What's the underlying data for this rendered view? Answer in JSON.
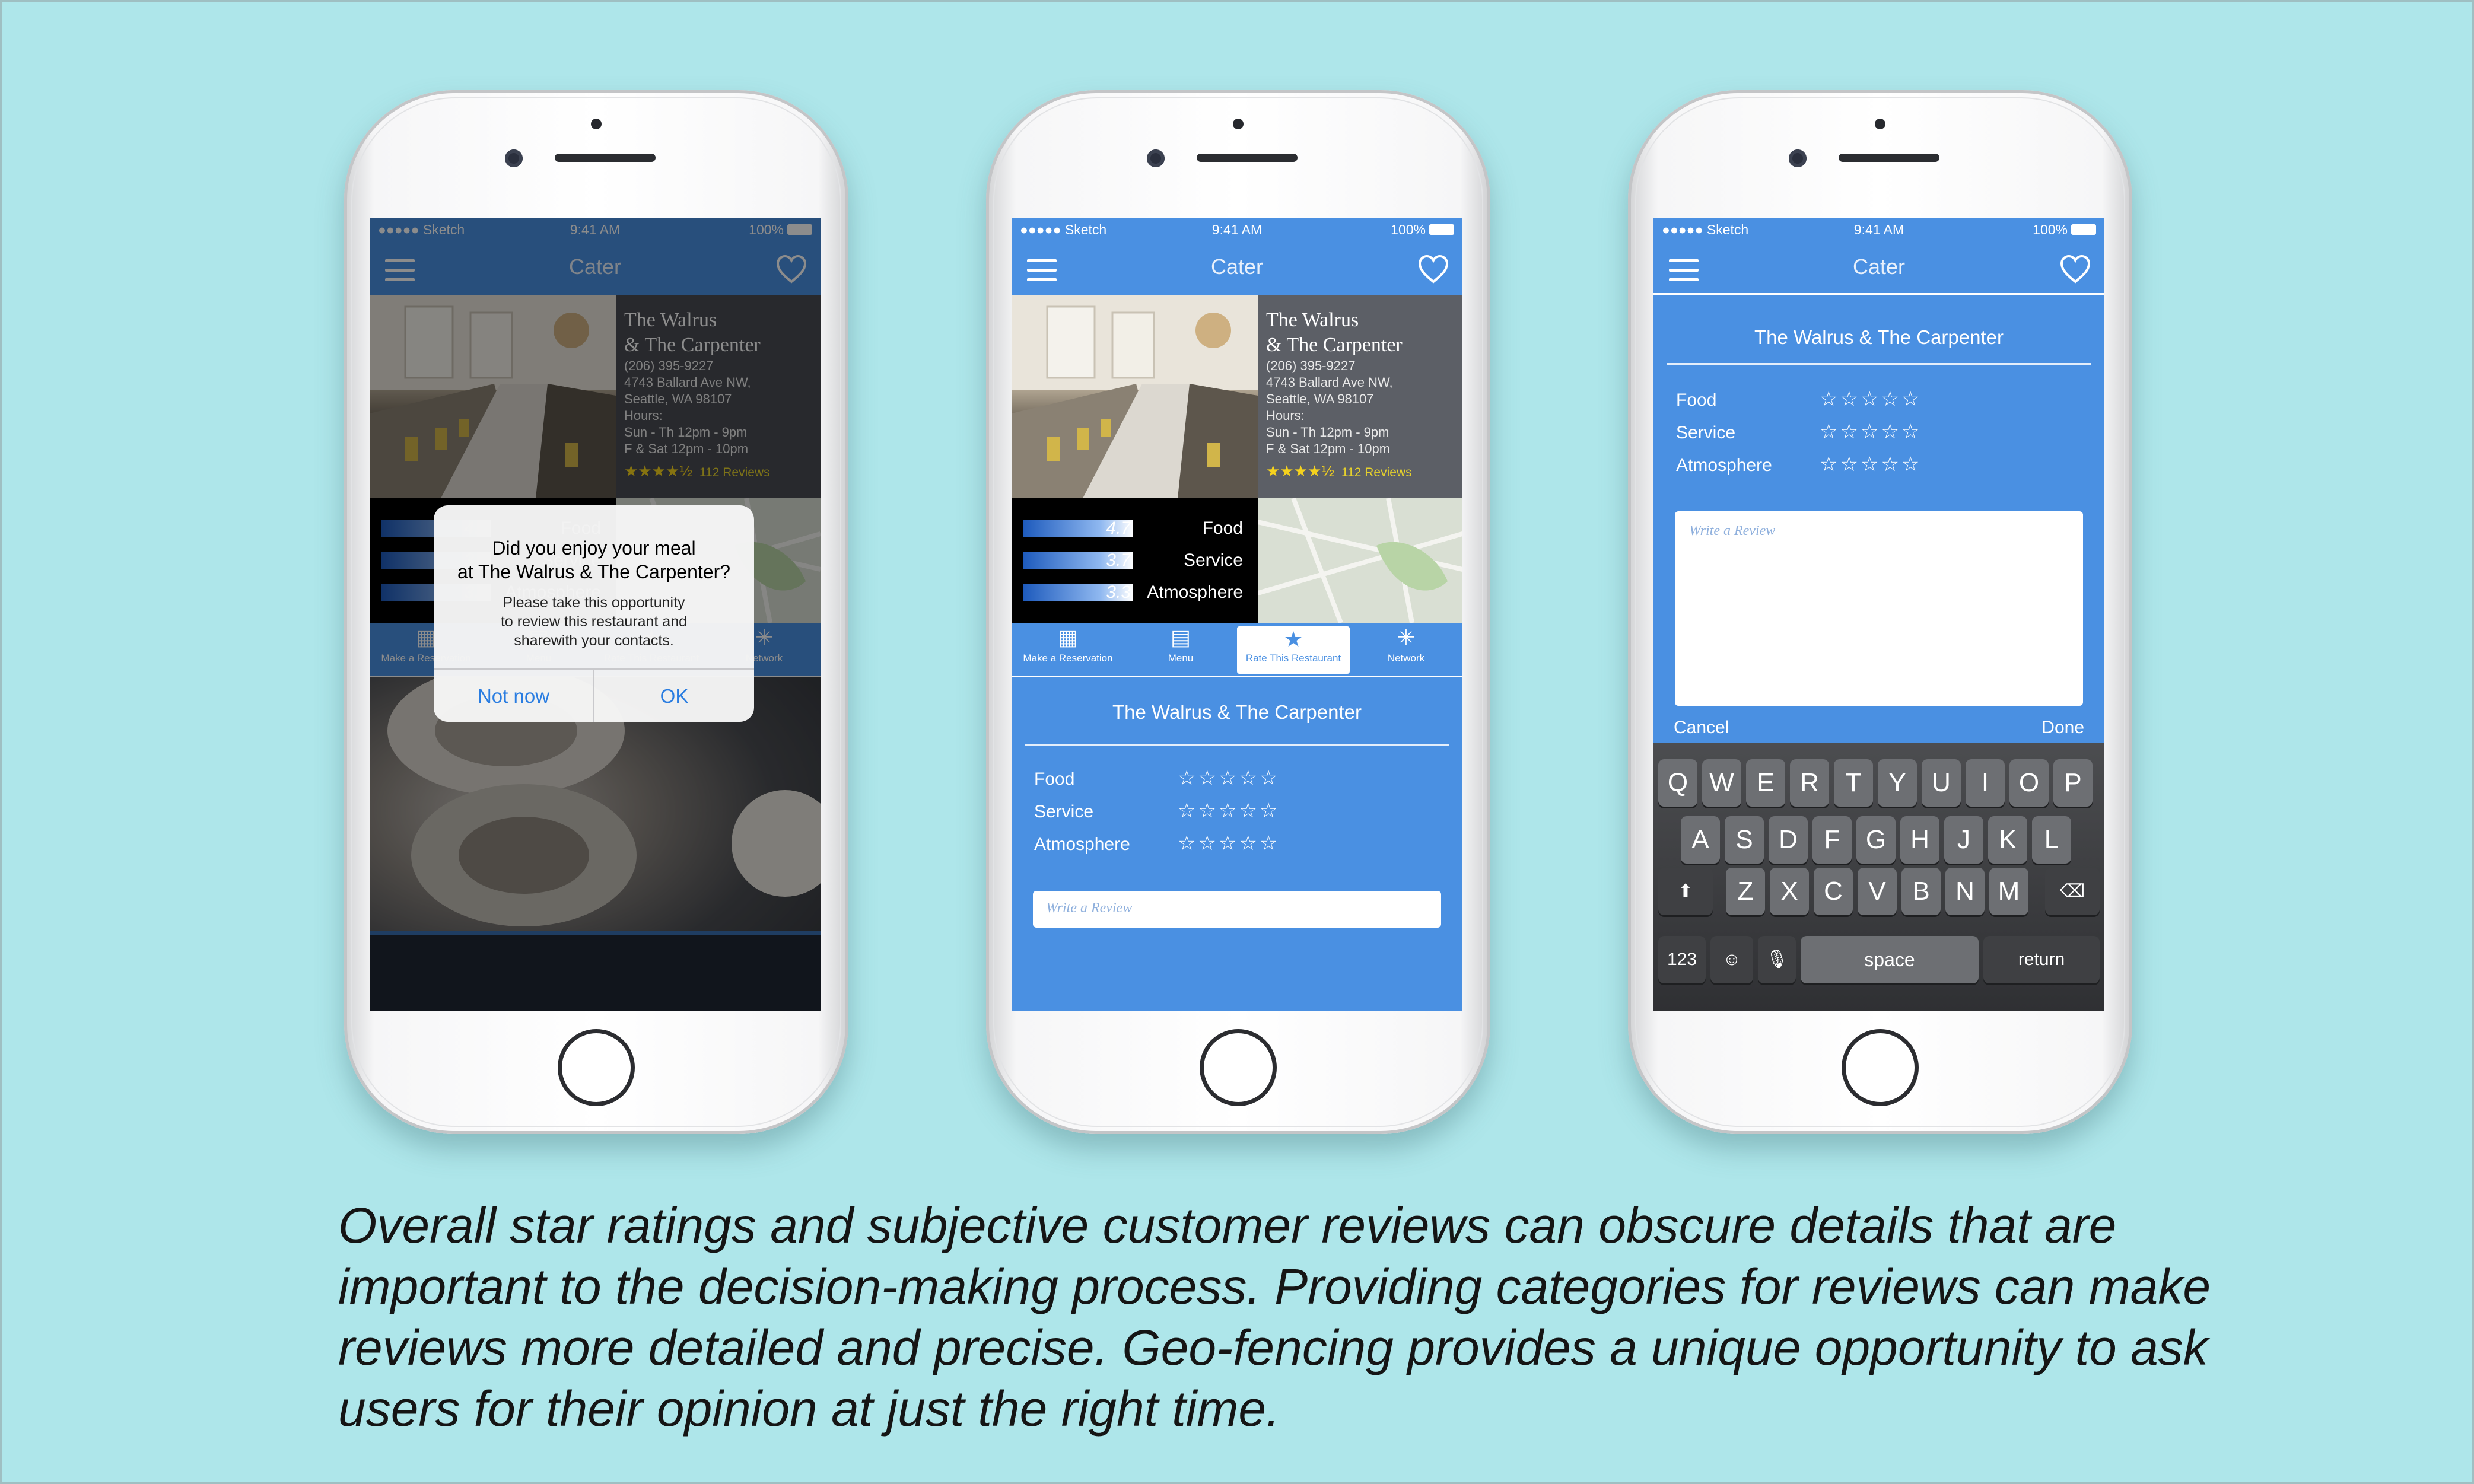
{
  "status_bar": {
    "carrier": "●●●●● Sketch",
    "time": "9:41 AM",
    "battery": "100%"
  },
  "app": {
    "title": "Cater"
  },
  "restaurant": {
    "name_line1": "The Walrus",
    "name_line2": "& The Carpenter",
    "full_name": "The Walrus & The Carpenter",
    "phone": "(206) 395-9227",
    "address1": "4743 Ballard Ave NW,",
    "address2": "Seattle, WA 98107",
    "hours_label": "Hours:",
    "hours1": "Sun - Th 12pm - 9pm",
    "hours2": "F & Sat  12pm - 10pm",
    "stars": "★★★★½",
    "rating_value": 4.5,
    "reviews": "112 Reviews"
  },
  "metrics": [
    {
      "label": "Food",
      "value": "4.7"
    },
    {
      "label": "Service",
      "value": "3.7"
    },
    {
      "label": "Atmosphere",
      "value": "3.3"
    }
  ],
  "tabs": [
    {
      "label": "Make a Reservation",
      "icon": "calendar-icon"
    },
    {
      "label": "Menu",
      "icon": "book-icon"
    },
    {
      "label": "Rate This Restaurant",
      "icon": "star-icon"
    },
    {
      "label": "Network",
      "icon": "network-icon"
    }
  ],
  "alert": {
    "title_line1": "Did you enjoy your meal",
    "title_line2": "at The Walrus & The Carpenter?",
    "msg1": "Please take this opportunity",
    "msg2": "to review this restaurant and",
    "msg3": "sharewith your contacts.",
    "btn_cancel": "Not now",
    "btn_ok": "OK"
  },
  "rating_form": {
    "categories": [
      "Food",
      "Service",
      "Atmosphere"
    ],
    "empty_stars": "☆☆☆☆☆",
    "placeholder": "Write a Review",
    "cancel": "Cancel",
    "done": "Done"
  },
  "keyboard": {
    "row1": [
      "Q",
      "W",
      "E",
      "R",
      "T",
      "Y",
      "U",
      "I",
      "O",
      "P"
    ],
    "row2": [
      "A",
      "S",
      "D",
      "F",
      "G",
      "H",
      "J",
      "K",
      "L"
    ],
    "row3": [
      "Z",
      "X",
      "C",
      "V",
      "B",
      "N",
      "M"
    ],
    "numbers": "123",
    "space": "space",
    "return": "return"
  },
  "caption": "Overall star ratings and subjective customer reviews can obscure details that are important to the decision-making process. Providing categories for reviews can make reviews more detailed and precise. Geo-fencing provides a unique opportunity to ask users for their opinion at just the right time.",
  "colors": {
    "background": "#aee6ea",
    "app_blue": "#4a90e2",
    "star_yellow": "#f5d21e",
    "ios_link": "#2a7de1"
  }
}
